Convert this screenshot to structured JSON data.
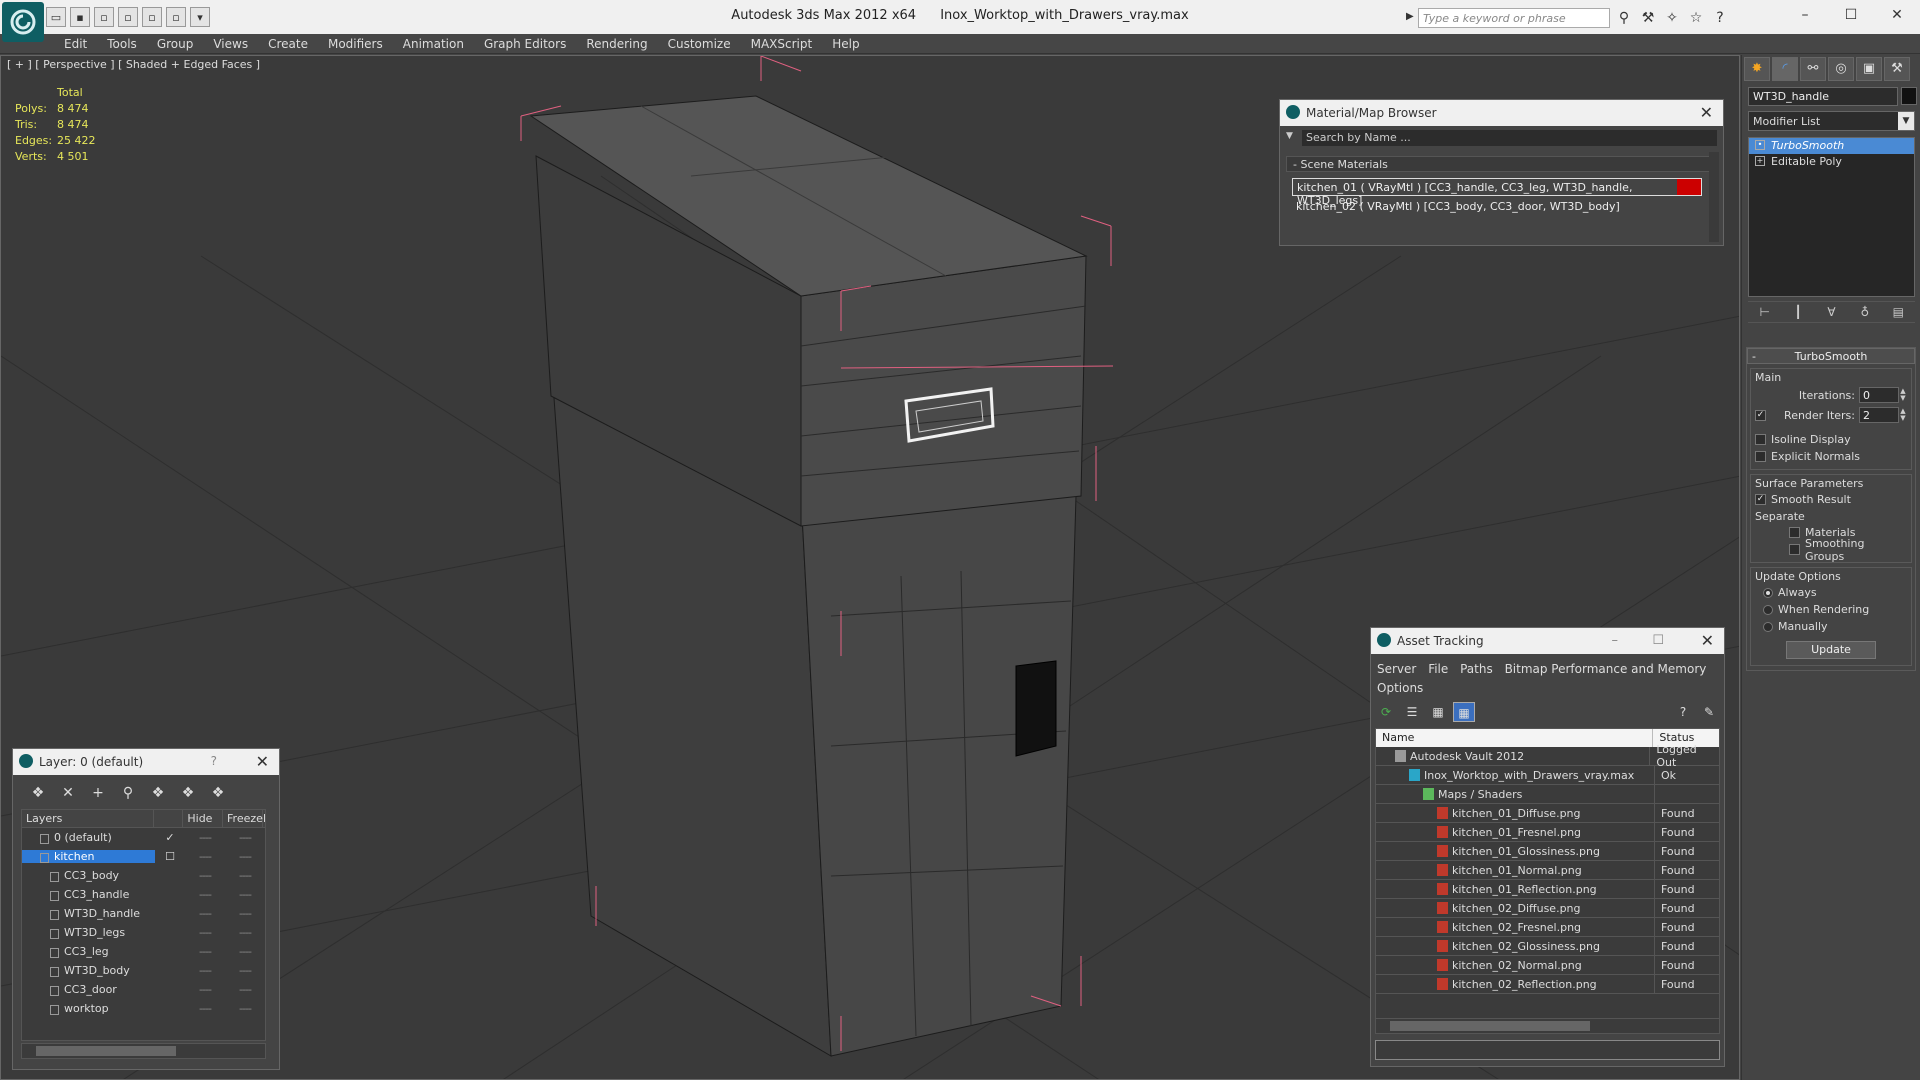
{
  "window": {
    "app_title": "Autodesk 3ds Max  2012 x64",
    "file_title": "Inox_Worktop_with_Drawers_vray.max",
    "search_placeholder": "Type a keyword or phrase"
  },
  "menu": [
    "Edit",
    "Tools",
    "Group",
    "Views",
    "Create",
    "Modifiers",
    "Animation",
    "Graph Editors",
    "Rendering",
    "Customize",
    "MAXScript",
    "Help"
  ],
  "viewport": {
    "label": "[ + ] [ Perspective ] [ Shaded + Edged Faces ]",
    "stats": {
      "header": "Total",
      "rows": [
        {
          "label": "Polys:",
          "value": "8 474"
        },
        {
          "label": "Tris:",
          "value": "8 474"
        },
        {
          "label": "Edges:",
          "value": "25 422"
        },
        {
          "label": "Verts:",
          "value": "4 501"
        }
      ]
    }
  },
  "command_panel": {
    "object_name": "WT3D_handle",
    "modifier_list_label": "Modifier List",
    "stack": [
      {
        "label": "TurboSmooth",
        "selected": true
      },
      {
        "label": "Editable Poly",
        "selected": false
      }
    ],
    "rollout_title": "TurboSmooth",
    "main_group": "Main",
    "iterations_label": "Iterations:",
    "iterations_value": "0",
    "render_iters_label": "Render Iters:",
    "render_iters_value": "2",
    "render_iters_checked": "✓",
    "isoline_label": "Isoline Display",
    "explicit_normals_label": "Explicit Normals",
    "surface_group": "Surface Parameters",
    "smooth_result_label": "Smooth Result",
    "smooth_result_checked": "✓",
    "separate_label": "Separate",
    "materials_label": "Materials",
    "smoothing_groups_label": "Smoothing Groups",
    "update_group": "Update Options",
    "always_label": "Always",
    "when_rendering_label": "When Rendering",
    "manually_label": "Manually",
    "update_button": "Update"
  },
  "layer_dialog": {
    "title": "Layer: 0 (default)",
    "help": "?",
    "columns": [
      "Layers",
      "Hide",
      "Freeze",
      "R"
    ],
    "rows": [
      {
        "name": "0 (default)",
        "check": "✓",
        "level": "top"
      },
      {
        "name": "kitchen",
        "check": "☐",
        "level": "top",
        "selected": true
      },
      {
        "name": "CC3_body",
        "level": "child"
      },
      {
        "name": "CC3_handle",
        "level": "child"
      },
      {
        "name": "WT3D_handle",
        "level": "child"
      },
      {
        "name": "WT3D_legs",
        "level": "child"
      },
      {
        "name": "CC3_leg",
        "level": "child"
      },
      {
        "name": "WT3D_body",
        "level": "child"
      },
      {
        "name": "CC3_door",
        "level": "child"
      },
      {
        "name": "worktop",
        "level": "child"
      }
    ],
    "dash": "----"
  },
  "material_browser": {
    "title": "Material/Map Browser",
    "search_placeholder": "Search by Name ...",
    "section": "- Scene Materials",
    "items": [
      "kitchen_01  ( VRayMtl )  [CC3_handle, CC3_leg, WT3D_handle, WT3D_legs]",
      "kitchen_02  ( VRayMtl )  [CC3_body, CC3_door, WT3D_body]"
    ],
    "swatch_color": "#cc0000"
  },
  "asset_tracking": {
    "title": "Asset Tracking",
    "menus_line1": [
      "Server",
      "File",
      "Paths",
      "Bitmap Performance and Memory"
    ],
    "menus_line2": [
      "Options"
    ],
    "columns": [
      "Name",
      "Status"
    ],
    "rows": [
      {
        "name": "Autodesk Vault 2012",
        "status": "Logged Out",
        "indent": 1,
        "icon": "vault"
      },
      {
        "name": "Inox_Worktop_with_Drawers_vray.max",
        "status": "Ok",
        "indent": 2,
        "icon": "max"
      },
      {
        "name": "Maps / Shaders",
        "status": "",
        "indent": 3,
        "icon": "maps"
      },
      {
        "name": "kitchen_01_Diffuse.png",
        "status": "Found",
        "indent": 4,
        "icon": "png"
      },
      {
        "name": "kitchen_01_Fresnel.png",
        "status": "Found",
        "indent": 4,
        "icon": "png"
      },
      {
        "name": "kitchen_01_Glossiness.png",
        "status": "Found",
        "indent": 4,
        "icon": "png"
      },
      {
        "name": "kitchen_01_Normal.png",
        "status": "Found",
        "indent": 4,
        "icon": "png"
      },
      {
        "name": "kitchen_01_Reflection.png",
        "status": "Found",
        "indent": 4,
        "icon": "png"
      },
      {
        "name": "kitchen_02_Diffuse.png",
        "status": "Found",
        "indent": 4,
        "icon": "png"
      },
      {
        "name": "kitchen_02_Fresnel.png",
        "status": "Found",
        "indent": 4,
        "icon": "png"
      },
      {
        "name": "kitchen_02_Glossiness.png",
        "status": "Found",
        "indent": 4,
        "icon": "png"
      },
      {
        "name": "kitchen_02_Normal.png",
        "status": "Found",
        "indent": 4,
        "icon": "png"
      },
      {
        "name": "kitchen_02_Reflection.png",
        "status": "Found",
        "indent": 4,
        "icon": "png"
      }
    ]
  },
  "colors": {
    "accent": "#2e7ad6",
    "stats_text": "#e6e659",
    "selection_box": "#e06080"
  }
}
